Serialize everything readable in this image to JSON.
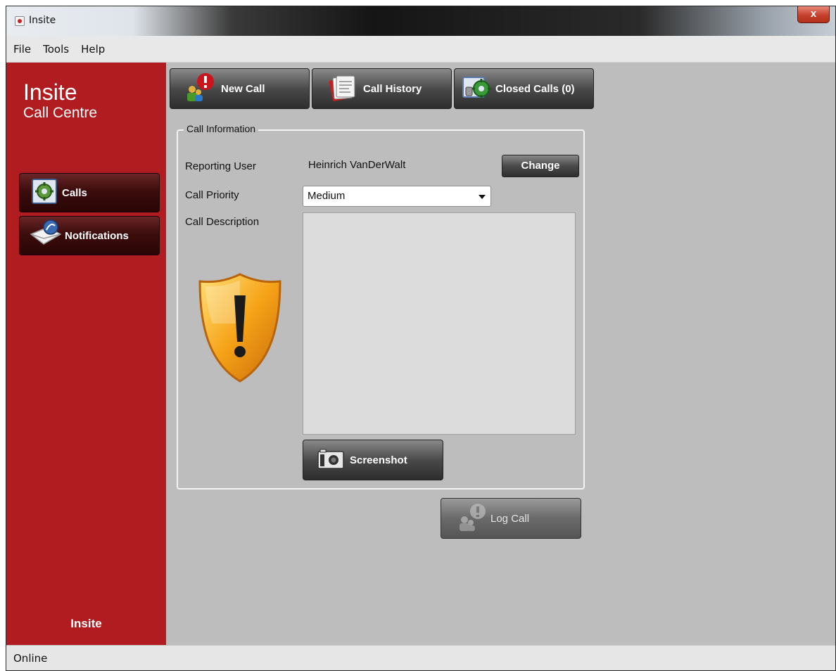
{
  "window": {
    "title": "Insite",
    "close_label": "x"
  },
  "menu": {
    "items": [
      "File",
      "Tools",
      "Help"
    ]
  },
  "sidebar": {
    "brand_title": "Insite",
    "brand_subtitle": "Call Centre",
    "nav": [
      {
        "label": "Calls",
        "icon": "calls-icon"
      },
      {
        "label": "Notifications",
        "icon": "notifications-icon"
      }
    ],
    "footer": "Insite"
  },
  "toolbar": {
    "new_call": "New Call",
    "call_history": "Call History",
    "closed_calls": "Closed Calls (0)"
  },
  "form": {
    "group_title": "Call Information",
    "reporting_user_label": "Reporting User",
    "reporting_user_value": "Heinrich VanDerWalt",
    "change_button": "Change",
    "priority_label": "Call Priority",
    "priority_value": "Medium",
    "description_label": "Call Description",
    "description_value": "",
    "screenshot_button": "Screenshot",
    "log_call_button": "Log Call"
  },
  "status": {
    "text": "Online"
  },
  "colors": {
    "sidebar_red": "#b01c20",
    "content_gray": "#bdbdbd"
  }
}
